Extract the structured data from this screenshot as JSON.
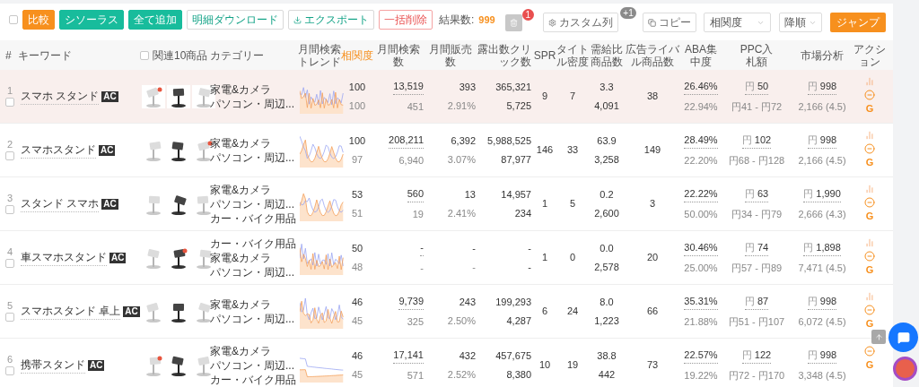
{
  "toolbar": {
    "select_all": {
      "checked": false
    },
    "buttons": [
      {
        "label": "比較",
        "kind": "primary"
      },
      {
        "label": "シソーラス",
        "kind": "teal"
      },
      {
        "label": "全て追加",
        "kind": "teal"
      },
      {
        "label": "明細ダウンロード",
        "kind": "outline"
      },
      {
        "label": "エクスポート",
        "kind": "export"
      },
      {
        "label": "一括削除",
        "kind": "danger"
      }
    ],
    "result_label": "結果数:",
    "result_count": "999",
    "trash_badge": "1",
    "custom_columns": {
      "label": "カスタム列",
      "badge": "+1"
    },
    "copy": {
      "label": "コピー"
    },
    "sort_field": {
      "value": "相関度"
    },
    "sort_order": {
      "value": "降順"
    },
    "jump": {
      "label": "ジャンプ"
    }
  },
  "table": {
    "columns": [
      {
        "label": "#",
        "active": false
      },
      {
        "label": "キーワード",
        "active": false
      },
      {
        "label": "関連10商品",
        "active": false
      },
      {
        "label": "カテゴリー",
        "active": false
      },
      {
        "label": "月間検索トレンド",
        "active": false
      },
      {
        "label": "相関度",
        "active": true
      },
      {
        "label": "月間検索数",
        "active": false
      },
      {
        "label": "月間販売数",
        "active": false
      },
      {
        "label": "露出数クリック数",
        "active": false
      },
      {
        "label": "SPR",
        "active": false
      },
      {
        "label": "タイトル密度",
        "active": false
      },
      {
        "label": "需給比商品数",
        "active": false
      },
      {
        "label": "広告ライバル商品数",
        "active": false
      },
      {
        "label": "ABA集中度",
        "active": false
      },
      {
        "label": "PPC入札額",
        "active": false
      },
      {
        "label": "市場分析",
        "active": false
      },
      {
        "label": "アクション",
        "active": false
      }
    ],
    "header_checkbox": {
      "checked": false
    },
    "rows": [
      {
        "index": "1",
        "selected": true,
        "checked": false,
        "keyword": "スマホ スタンド",
        "badge": "AC",
        "images": [
          {
            "kind": "picture"
          },
          {
            "kind": "picture"
          },
          {
            "kind": "picture"
          }
        ],
        "categories": [
          "家電&カメラ",
          "パソコン・周辺..."
        ],
        "relevance": "100",
        "relevance_sub": "100",
        "searches": "13,519",
        "searches_sub": "451",
        "sales": "393",
        "sales_sub": "2.91%",
        "exposure": "365,321",
        "clicks": "5,725",
        "spr": "9",
        "title_density": "7",
        "supply_ratio": "3.3",
        "products": "4,091",
        "ad_rivals": "38",
        "aba": "26.46%",
        "aba_sub": "22.94%",
        "ppc_currency": "円",
        "ppc": "50",
        "ppc_range": "円41 - 円72",
        "market_currency": "円",
        "market": "998",
        "market_sub": "2,166 (4.5)",
        "actions": [
          {
            "kind": "chart"
          },
          {
            "kind": "exclude"
          },
          {
            "kind": "google",
            "label": "G"
          }
        ]
      },
      {
        "index": "2",
        "selected": false,
        "checked": false,
        "keyword": "スマホスタンド",
        "badge": "AC",
        "images": [
          {
            "kind": "picture"
          },
          {
            "kind": "picture"
          },
          {
            "kind": "picture"
          }
        ],
        "categories": [
          "家電&カメラ",
          "パソコン・周辺..."
        ],
        "relevance": "100",
        "relevance_sub": "97",
        "searches": "208,211",
        "searches_sub": "6,940",
        "sales": "6,392",
        "sales_sub": "3.07%",
        "exposure": "5,988,525",
        "clicks": "87,977",
        "spr": "146",
        "title_density": "33",
        "supply_ratio": "63.9",
        "products": "3,258",
        "ad_rivals": "149",
        "aba": "28.49%",
        "aba_sub": "22.20%",
        "ppc_currency": "円",
        "ppc": "102",
        "ppc_range": "円68 - 円128",
        "market_currency": "円",
        "market": "998",
        "market_sub": "2,166 (4.5)",
        "actions": [
          {
            "kind": "chart"
          },
          {
            "kind": "exclude"
          },
          {
            "kind": "google",
            "label": "G"
          }
        ]
      },
      {
        "index": "3",
        "selected": false,
        "checked": false,
        "keyword": "スタンド スマホ",
        "badge": "AC",
        "images": [
          {
            "kind": "picture"
          },
          {
            "kind": "picture"
          },
          {
            "kind": "picture"
          }
        ],
        "categories": [
          "家電&カメラ",
          "パソコン・周辺...",
          "カー・バイク用品"
        ],
        "relevance": "53",
        "relevance_sub": "51",
        "searches": "560",
        "searches_sub": "19",
        "sales": "13",
        "sales_sub": "2.41%",
        "exposure": "14,957",
        "clicks": "234",
        "spr": "1",
        "title_density": "5",
        "supply_ratio": "0.2",
        "products": "2,600",
        "ad_rivals": "3",
        "aba": "22.22%",
        "aba_sub": "50.00%",
        "ppc_currency": "円",
        "ppc": "63",
        "ppc_range": "円34 - 円79",
        "market_currency": "円",
        "market": "1,990",
        "market_sub": "2,666 (4.3)",
        "actions": [
          {
            "kind": "chart"
          },
          {
            "kind": "exclude"
          },
          {
            "kind": "google",
            "label": "G"
          }
        ]
      },
      {
        "index": "4",
        "selected": false,
        "checked": false,
        "keyword": "車スマホスタンド",
        "badge": "AC",
        "images": [
          {
            "kind": "picture"
          },
          {
            "kind": "picture"
          },
          {
            "kind": "picture"
          }
        ],
        "categories": [
          "カー・バイク用品",
          "家電&カメラ",
          "パソコン・周辺..."
        ],
        "relevance": "50",
        "relevance_sub": "48",
        "searches": "-",
        "searches_sub": "-",
        "sales": "-",
        "sales_sub": "-",
        "exposure": "-",
        "clicks": "-",
        "spr": "1",
        "title_density": "0",
        "supply_ratio": "0.0",
        "products": "2,578",
        "ad_rivals": "20",
        "aba": "30.46%",
        "aba_sub": "25.00%",
        "ppc_currency": "円",
        "ppc": "74",
        "ppc_range": "円57 - 円89",
        "market_currency": "円",
        "market": "1,898",
        "market_sub": "7,471 (4.5)",
        "actions": [
          {
            "kind": "chart"
          },
          {
            "kind": "exclude"
          },
          {
            "kind": "google",
            "label": "G"
          }
        ]
      },
      {
        "index": "5",
        "selected": false,
        "checked": false,
        "keyword": "スマホスタンド 卓上",
        "badge": "AC",
        "images": [
          {
            "kind": "picture"
          },
          {
            "kind": "picture"
          },
          {
            "kind": "picture"
          }
        ],
        "categories": [
          "家電&カメラ",
          "パソコン・周辺..."
        ],
        "relevance": "46",
        "relevance_sub": "45",
        "searches": "9,739",
        "searches_sub": "325",
        "sales": "243",
        "sales_sub": "2.50%",
        "exposure": "199,293",
        "clicks": "4,287",
        "spr": "6",
        "title_density": "24",
        "supply_ratio": "8.0",
        "products": "1,223",
        "ad_rivals": "66",
        "aba": "35.31%",
        "aba_sub": "21.88%",
        "ppc_currency": "円",
        "ppc": "87",
        "ppc_range": "円51 - 円107",
        "market_currency": "円",
        "market": "998",
        "market_sub": "6,072 (4.5)",
        "actions": [
          {
            "kind": "chart"
          },
          {
            "kind": "exclude"
          },
          {
            "kind": "google",
            "label": "G"
          }
        ]
      },
      {
        "index": "6",
        "selected": false,
        "checked": false,
        "keyword": "携帯スタンド",
        "badge": "AC",
        "images": [
          {
            "kind": "picture"
          },
          {
            "kind": "picture"
          },
          {
            "kind": "picture"
          }
        ],
        "categories": [
          "家電&カメラ",
          "パソコン・周辺...",
          "カー・バイク用品"
        ],
        "relevance": "46",
        "relevance_sub": "45",
        "searches": "17,141",
        "searches_sub": "571",
        "sales": "432",
        "sales_sub": "2.52%",
        "exposure": "457,675",
        "clicks": "8,380",
        "spr": "10",
        "title_density": "19",
        "supply_ratio": "38.8",
        "products": "442",
        "ad_rivals": "73",
        "aba": "22.57%",
        "aba_sub": "19.22%",
        "ppc_currency": "円",
        "ppc": "122",
        "ppc_range": "円72 - 円170",
        "market_currency": "円",
        "market": "998",
        "market_sub": "3,348 (4.5)",
        "actions": [
          {
            "kind": "exclude"
          },
          {
            "kind": "google",
            "label": "G"
          }
        ]
      }
    ]
  }
}
